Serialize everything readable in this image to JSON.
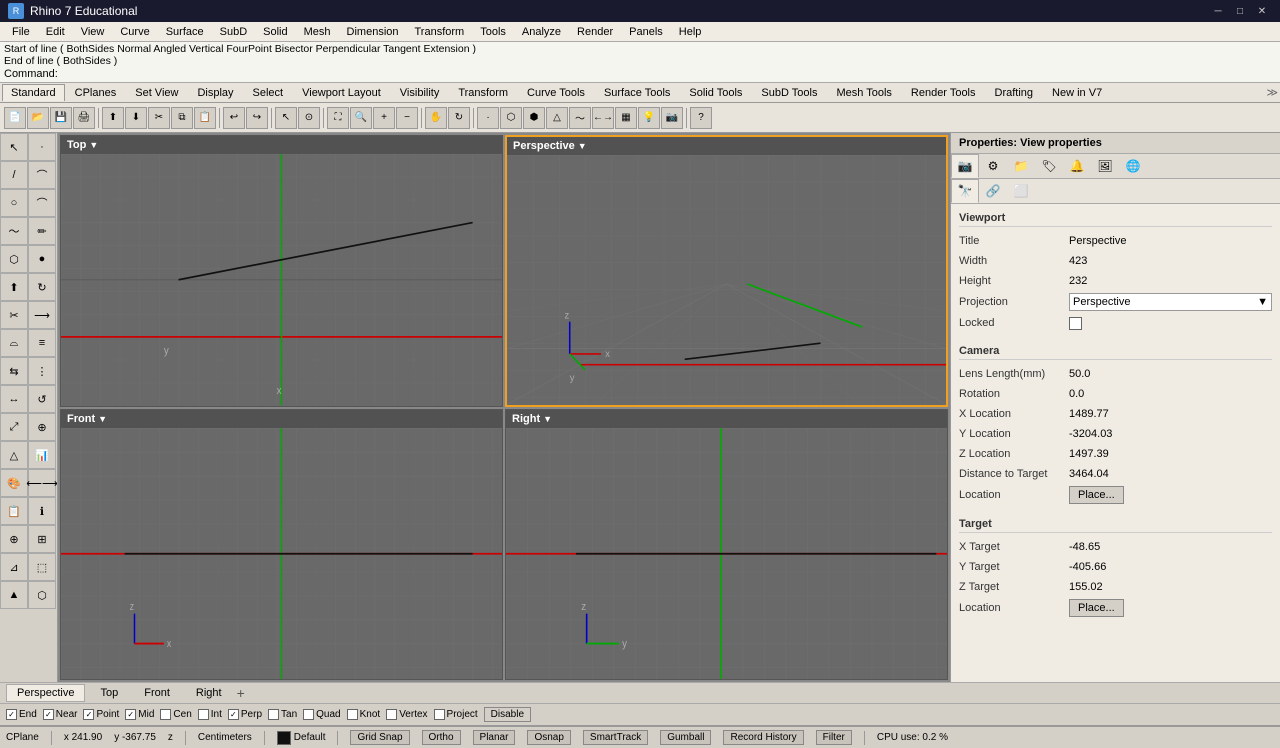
{
  "title": {
    "app_name": "Rhino 7 Educational",
    "icon_label": "R"
  },
  "win_controls": {
    "minimize": "─",
    "restore": "□",
    "close": "✕"
  },
  "menu": {
    "items": [
      "File",
      "Edit",
      "View",
      "Curve",
      "Surface",
      "SubD",
      "Solid",
      "Mesh",
      "Dimension",
      "Transform",
      "Tools",
      "Analyze",
      "Render",
      "Panels",
      "Help"
    ]
  },
  "command_area": {
    "line1": "Start of line ( BothSides  Normal  Angled  Vertical  FourPoint  Bisector  Perpendicular  Tangent  Extension )",
    "line2": "End of line ( BothSides )",
    "prompt": "Command:"
  },
  "toolbar_tabs": [
    "Standard",
    "CPlanes",
    "Set View",
    "Display",
    "Select",
    "Viewport Layout",
    "Visibility",
    "Transform",
    "Curve Tools",
    "Surface Tools",
    "Solid Tools",
    "SubD Tools",
    "Mesh Tools",
    "Render Tools",
    "Drafting",
    "New in V7"
  ],
  "viewports": {
    "top": {
      "label": "Top",
      "active": false
    },
    "perspective": {
      "label": "Perspective",
      "active": true
    },
    "front": {
      "label": "Front",
      "active": false
    },
    "right": {
      "label": "Right",
      "active": false
    }
  },
  "viewport_tabs": {
    "tabs": [
      "Perspective",
      "Top",
      "Front",
      "Right"
    ],
    "active": "Perspective"
  },
  "snap_bar": {
    "items": [
      {
        "label": "End",
        "checked": true
      },
      {
        "label": "Near",
        "checked": true
      },
      {
        "label": "Point",
        "checked": true
      },
      {
        "label": "Mid",
        "checked": true
      },
      {
        "label": "Cen",
        "checked": false
      },
      {
        "label": "Int",
        "checked": false
      },
      {
        "label": "Perp",
        "checked": true
      },
      {
        "label": "Tan",
        "checked": false
      },
      {
        "label": "Quad",
        "checked": false
      },
      {
        "label": "Knot",
        "checked": false
      },
      {
        "label": "Vertex",
        "checked": false
      },
      {
        "label": "Project",
        "checked": false
      },
      {
        "label": "Disable",
        "checked": false,
        "style": "button"
      }
    ]
  },
  "status_bar": {
    "cplane": "CPlane",
    "x": "x  241.90",
    "y": "y  -367.75",
    "z": "z",
    "units": "Centimeters",
    "layer": "Default",
    "grid_snap": "Grid Snap",
    "ortho": "Ortho",
    "planar": "Planar",
    "osnap": "Osnap",
    "smarttrack": "SmartTrack",
    "gumball": "Gumball",
    "record_history": "Record History",
    "filter": "Filter",
    "cpu": "CPU use: 0.2 %"
  },
  "right_panel": {
    "header": "Properties: View properties",
    "tabs": [
      "camera",
      "settings",
      "folder",
      "tag",
      "bell",
      "image",
      "globe"
    ],
    "sub_tabs": [
      "cam2",
      "link",
      "rect"
    ],
    "section_viewport": "Viewport",
    "viewport_props": {
      "title_label": "Title",
      "title_value": "Perspective",
      "width_label": "Width",
      "width_value": "423",
      "height_label": "Height",
      "height_value": "232",
      "projection_label": "Projection",
      "projection_value": "Perspective",
      "locked_label": "Locked",
      "locked_checked": false
    },
    "section_camera": "Camera",
    "camera_props": {
      "lens_label": "Lens Length(mm)",
      "lens_value": "50.0",
      "rotation_label": "Rotation",
      "rotation_value": "0.0",
      "xloc_label": "X Location",
      "xloc_value": "1489.77",
      "yloc_label": "Y Location",
      "yloc_value": "-3204.03",
      "zloc_label": "Z Location",
      "zloc_value": "1497.39",
      "dist_label": "Distance to Target",
      "dist_value": "3464.04",
      "location_label": "Location",
      "location_btn": "Place..."
    },
    "section_target": "Target",
    "target_props": {
      "xtarget_label": "X Target",
      "xtarget_value": "-48.65",
      "ytarget_label": "Y Target",
      "ytarget_value": "-405.66",
      "ztarget_label": "Z Target",
      "ztarget_value": "155.02",
      "location_label": "Location",
      "location_btn": "Place..."
    }
  }
}
